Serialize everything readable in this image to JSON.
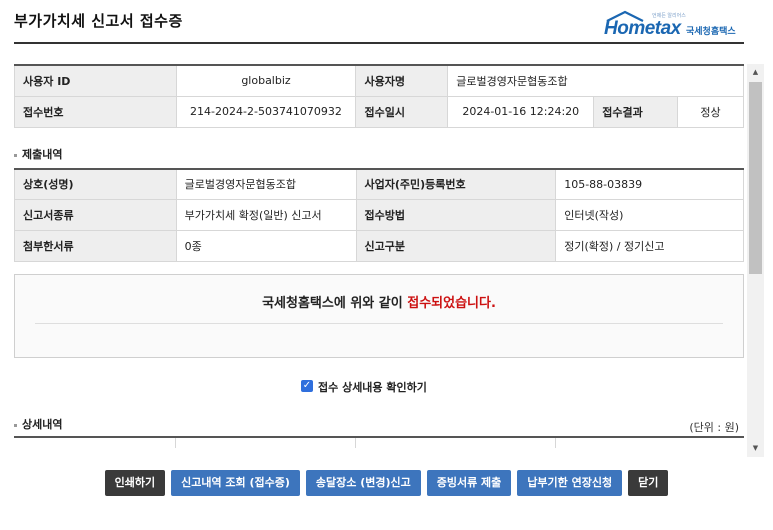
{
  "header": {
    "title": "부가가치세 신고서 접수증",
    "logo_text": "Hometax",
    "logo_sub": "국세청홈택스",
    "logo_slogan": "언제든 알리어스"
  },
  "user_info": {
    "user_id_label": "사용자 ID",
    "user_id": "globalbiz",
    "user_name_label": "사용자명",
    "user_name": "글로벌경영자문협동조합",
    "receipt_no_label": "접수번호",
    "receipt_no": "214-2024-2-503741070932",
    "receipt_time_label": "접수일시",
    "receipt_time": "2024-01-16 12:24:20",
    "result_label": "접수결과",
    "result": "정상"
  },
  "submission": {
    "section_title": "제출내역",
    "rows": [
      {
        "label1": "상호(성명)",
        "value1": "글로벌경영자문협동조합",
        "label2": "사업자(주민)등록번호",
        "value2": "105-88-03839"
      },
      {
        "label1": "신고서종류",
        "value1": "부가가치세 확정(일반) 신고서",
        "label2": "접수방법",
        "value2": "인터넷(작성)"
      },
      {
        "label1": "첨부한서류",
        "value1": "0종",
        "label2": "신고구분",
        "value2": "정기(확정) / 정기신고"
      }
    ]
  },
  "notice": {
    "prefix": "국세청홈택스에 위와 같이 ",
    "highlight": "접수되었습니다."
  },
  "confirm": {
    "label": "접수 상세내용 확인하기",
    "checked": true
  },
  "detail": {
    "section_title": "상세내역",
    "unit": "(단위 : 원)"
  },
  "buttons": {
    "print": "인쇄하기",
    "view_receipt": "신고내역 조회 (접수증)",
    "change_address": "송달장소 (변경)신고",
    "submit_docs": "증빙서류 제출",
    "extend_payment": "납부기한 연장신청",
    "close": "닫기"
  },
  "colors": {
    "accent_red": "#cc1111",
    "button_blue": "#3d75bd",
    "button_dark": "#3a3a3a",
    "logo_blue": "#1b67b2"
  }
}
